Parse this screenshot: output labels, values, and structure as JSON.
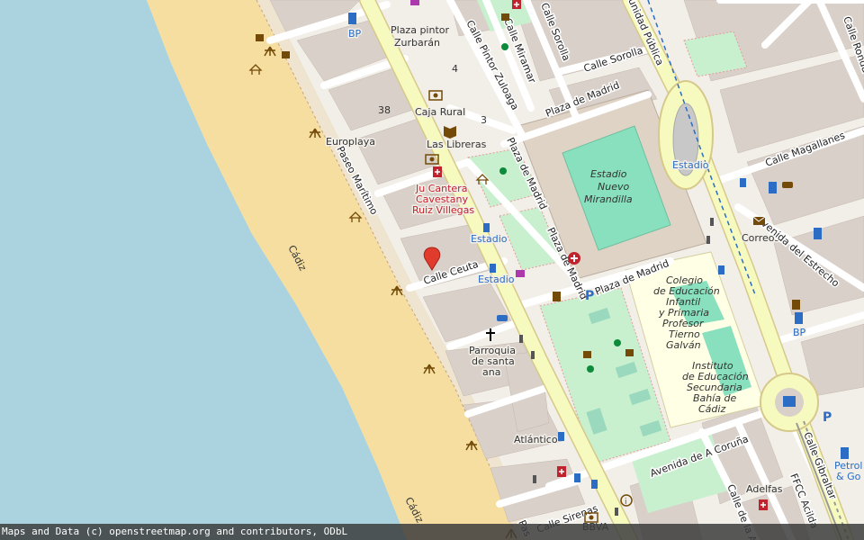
{
  "map": {
    "labels": {
      "plaza_pintor_zurbaran_1": "Plaza pintor",
      "plaza_pintor_zurbaran_2": "Zurbarán",
      "caja_rural": "Caja Rural",
      "las_libreras": "Las Libreras",
      "europlaya": "Europlaya",
      "ju_cantera_1": "Ju Cantera",
      "ju_cantera_2": "Cavestany",
      "ju_cantera_3": "Ruiz Villegas",
      "estadio_bus_1": "Estadio",
      "estadio_bus_2": "Estadio",
      "estadio_rail": "Estadio",
      "stadium_1": "Estadio",
      "stadium_2": "Nuevo",
      "stadium_3": "Mirandilla",
      "correos": "Correos",
      "bp_1": "BP",
      "bp_2": "BP",
      "parroquia_1": "Parroquia",
      "parroquia_2": "de santa",
      "parroquia_3": "ana",
      "atlantico": "Atlántico",
      "adelfas": "Adelfas",
      "petrol_1": "Petrol",
      "petrol_2": "& Go",
      "bbva": "BBVA",
      "colegio_1": "Colegio",
      "colegio_2": "de Educación",
      "colegio_3": "Infantil",
      "colegio_4": "y Primaria",
      "colegio_5": "Profesor",
      "colegio_6": "Tierno",
      "colegio_7": "Galván",
      "instituto_1": "Instituto",
      "instituto_2": "de Educación",
      "instituto_3": "Secundaria",
      "instituto_4": "Bahía de",
      "instituto_5": "Cádiz",
      "num_38": "38",
      "num_4": "4",
      "num_3": "3",
      "cadiz_1": "Cádiz",
      "cadiz_2": "Cádiz"
    },
    "streets": {
      "paseo_maritimo": "Paseo Marítimo",
      "calle_ceuta": "Calle Ceuta",
      "calle_pintor_zuloaga": "Calle Pintor Zuloaga",
      "calle_miramar": "Calle Miramar",
      "calle_sorolla_1": "Calle Sorolla",
      "calle_sorolla_2": "Calle Sorolla",
      "plaza_de_madrid_1": "Plaza de Madrid",
      "plaza_de_madrid_2": "Plaza de Madrid",
      "plaza_de_madrid_3": "Plaza de Madrid",
      "plaza_de_madrid_4": "Plaza de Madrid",
      "calle_magallanes": "Calle Magallanes",
      "avenida_estrecho": "Avenida del Estrecho",
      "avenida_coruna": "Avenida de A Coruña",
      "calle_gibraltar": "Calle Gibraltar",
      "calle_sirenas": "Calle Sirenas",
      "calle_de_la_a": "Calle de la A",
      "calle_ronda": "Calle Ronda de Vig",
      "unidad_publica": "unidad Pública",
      "fecc": "FFCC Acilda",
      "paseo_bottom": "Pas"
    },
    "colors": {
      "sea": "#aad3df",
      "beach": "#f5dea0",
      "road_primary": "#f7fabf",
      "land": "#f2efe9",
      "building": "#d9d0c9",
      "pitch": "#88e0be",
      "school": "#ffffe5",
      "poi_blue": "#2b6cc4",
      "poi_red": "#c0232d",
      "poi_brown": "#734a08",
      "marker_red": "#e03b2c"
    }
  },
  "attribution": "Maps and Data (c) openstreetmap.org and contributors, ODbL"
}
